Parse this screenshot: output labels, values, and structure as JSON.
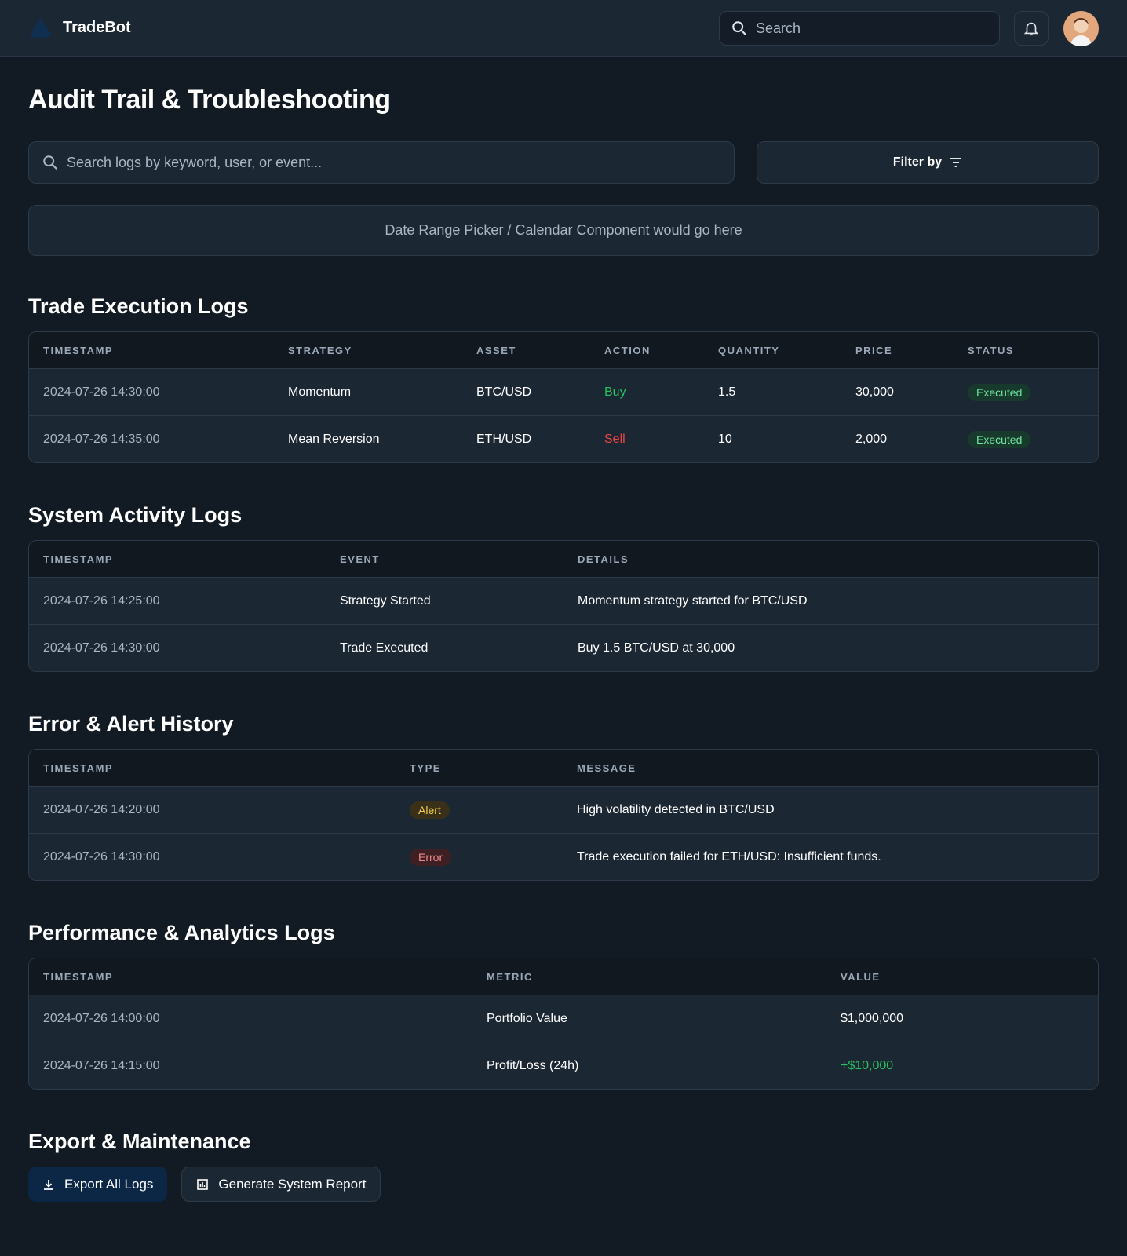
{
  "header": {
    "app_name": "TradeBot",
    "search_placeholder": "Search"
  },
  "page_title": "Audit Trail & Troubleshooting",
  "controls": {
    "search_placeholder": "Search logs by keyword, user, or event...",
    "filter_label": "Filter by",
    "date_placeholder": "Date Range Picker / Calendar Component would go here"
  },
  "trade": {
    "title": "Trade Execution Logs",
    "columns": [
      "TIMESTAMP",
      "STRATEGY",
      "ASSET",
      "ACTION",
      "QUANTITY",
      "PRICE",
      "STATUS"
    ],
    "rows": [
      [
        "2024-07-26 14:30:00",
        "Momentum",
        "BTC/USD",
        "Buy",
        "1.5",
        "30,000",
        "Executed"
      ],
      [
        "2024-07-26 14:35:00",
        "Mean Reversion",
        "ETH/USD",
        "Sell",
        "10",
        "2,000",
        "Executed"
      ]
    ]
  },
  "system": {
    "title": "System Activity Logs",
    "columns": [
      "TIMESTAMP",
      "EVENT",
      "DETAILS"
    ],
    "rows": [
      [
        "2024-07-26 14:25:00",
        "Strategy Started",
        "Momentum strategy started for BTC/USD"
      ],
      [
        "2024-07-26 14:30:00",
        "Trade Executed",
        "Buy 1.5 BTC/USD at 30,000"
      ]
    ]
  },
  "errors": {
    "title": "Error & Alert History",
    "columns": [
      "TIMESTAMP",
      "TYPE",
      "MESSAGE"
    ],
    "rows": [
      [
        "2024-07-26 14:20:00",
        "Alert",
        "High volatility detected in BTC/USD"
      ],
      [
        "2024-07-26 14:30:00",
        "Error",
        "Trade execution failed for ETH/USD: Insufficient funds."
      ]
    ]
  },
  "performance": {
    "title": "Performance & Analytics Logs",
    "columns": [
      "TIMESTAMP",
      "METRIC",
      "VALUE"
    ],
    "rows": [
      [
        "2024-07-26 14:00:00",
        "Portfolio Value",
        "$1,000,000"
      ],
      [
        "2024-07-26 14:15:00",
        "Profit/Loss (24h)",
        "+$10,000"
      ]
    ]
  },
  "export": {
    "title": "Export & Maintenance",
    "export_label": "Export All Logs",
    "report_label": "Generate System Report"
  },
  "colors": {
    "buy": "#27c25c",
    "sell": "#ee4444",
    "accent": "#0b2745"
  }
}
